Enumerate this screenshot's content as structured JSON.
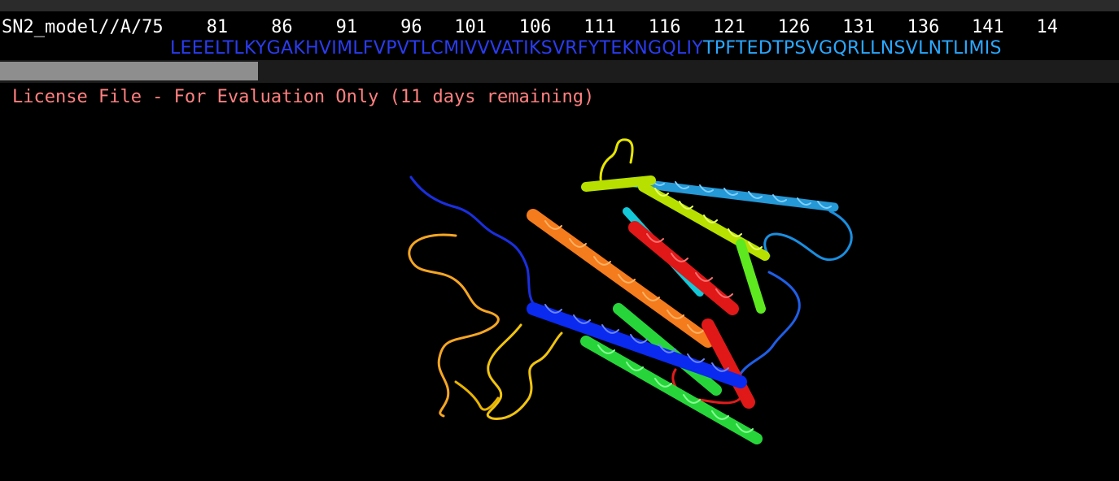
{
  "sequence_viewer": {
    "header": "SN2_model//A/75    81    86    91    96   101   106   111   116   121   126   131   136   141   14",
    "residues_blue": "LEEELTLKYGAKHVIMLFVPVTLCMIVVVATIKSVRFYTEKNGQLIY",
    "residues_light": "TPFTEDTPSVGQRLLNSVLNTLIMIS",
    "colors": {
      "residues_blue": "#2a3cf0",
      "residues_light": "#2aa8ff"
    }
  },
  "banner": {
    "license_text": "License File - For Evaluation Only (11 days remaining)"
  },
  "scrollbar": {
    "position_fraction": 0.0
  },
  "structure": {
    "representation": "cartoon",
    "coloring": "rainbow"
  }
}
